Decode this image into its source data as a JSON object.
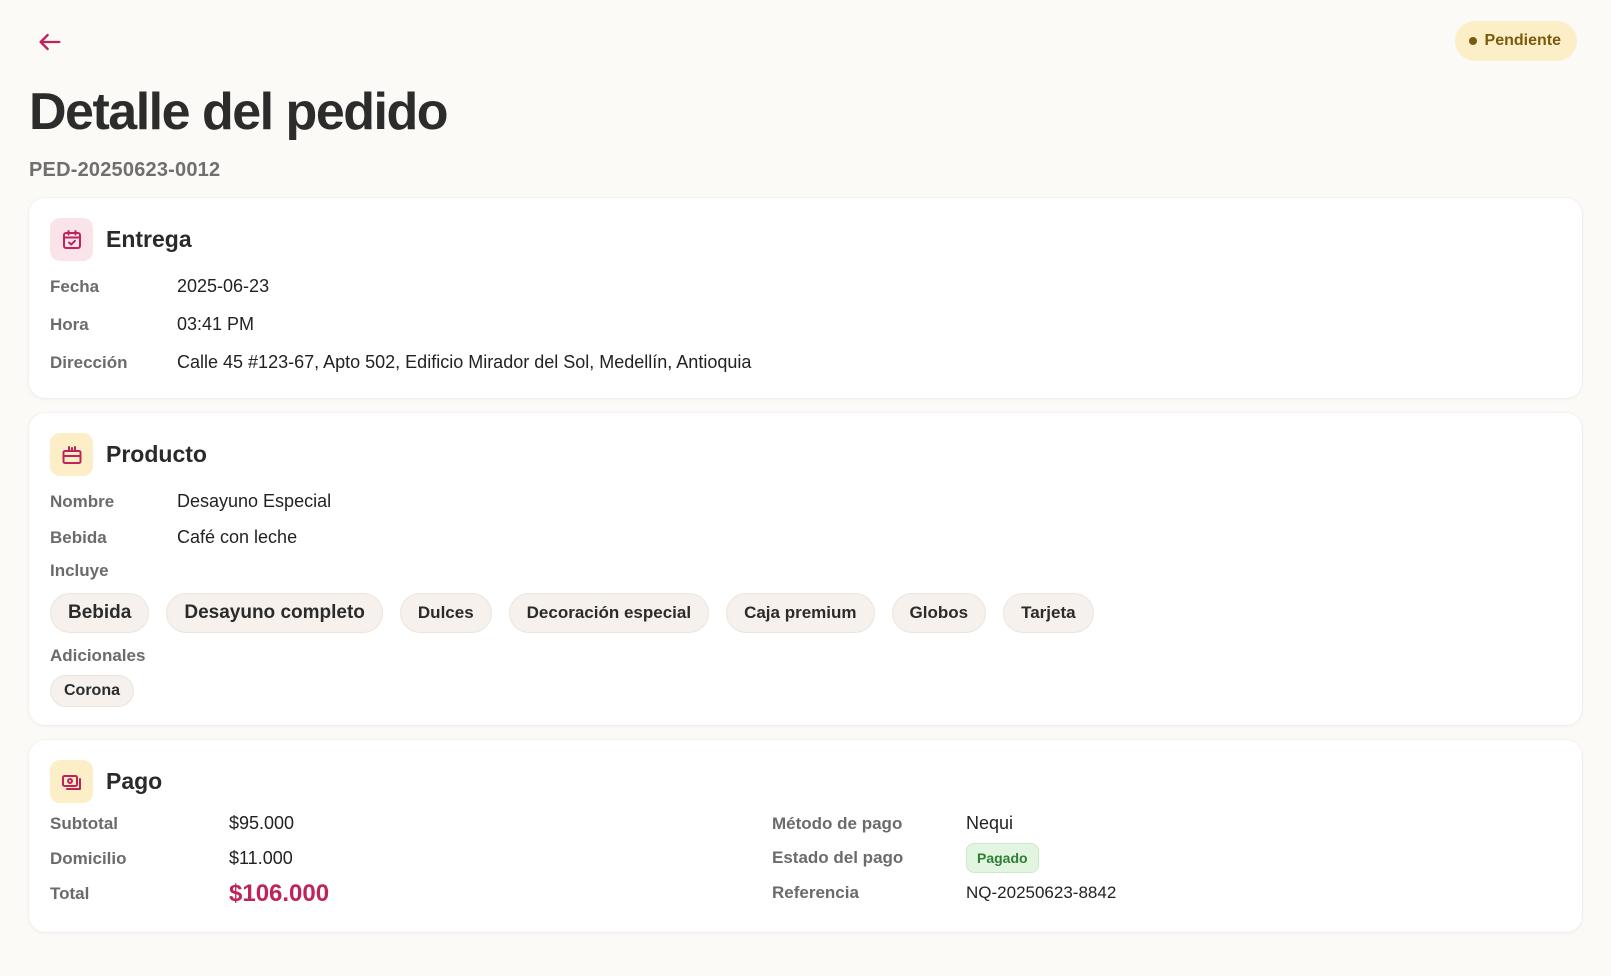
{
  "header": {
    "title": "Detalle del pedido",
    "order_id": "PED-20250623-0012",
    "status": "Pendiente"
  },
  "colors": {
    "accent": "#c0235b",
    "status_bg": "#fcefc7",
    "status_text": "#7a5a0e",
    "paid_bg": "#e2f5e1",
    "paid_text": "#2e7d32"
  },
  "delivery": {
    "title": "Entrega",
    "icon": "calendar-check-icon",
    "date_label": "Fecha",
    "date_value": "2025-06-23",
    "time_label": "Hora",
    "time_value": "03:41 PM",
    "address_label": "Dirección",
    "address_value": "Calle 45 #123-67, Apto 502, Edificio Mirador del Sol, Medellín, Antioquia"
  },
  "product": {
    "title": "Producto",
    "icon": "gift-icon",
    "name_label": "Nombre",
    "name_value": "Desayuno Especial",
    "drink_label": "Bebida",
    "drink_value": "Café con leche",
    "includes_label": "Incluye",
    "includes": [
      "Bebida",
      "Desayuno completo",
      "Dulces",
      "Decoración especial",
      "Caja premium",
      "Globos",
      "Tarjeta"
    ],
    "extras_label": "Adicionales",
    "extras": [
      "Corona"
    ]
  },
  "payment": {
    "title": "Pago",
    "icon": "payment-icon",
    "subtotal_label": "Subtotal",
    "subtotal_value": "$95.000",
    "delivery_label": "Domicilio",
    "delivery_value": "$11.000",
    "total_label": "Total",
    "total_value": "$106.000",
    "method_label": "Método de pago",
    "method_value": "Nequi",
    "status_label": "Estado del pago",
    "status_value": "Pagado",
    "reference_label": "Referencia",
    "reference_value": "NQ-20250623-8842"
  }
}
